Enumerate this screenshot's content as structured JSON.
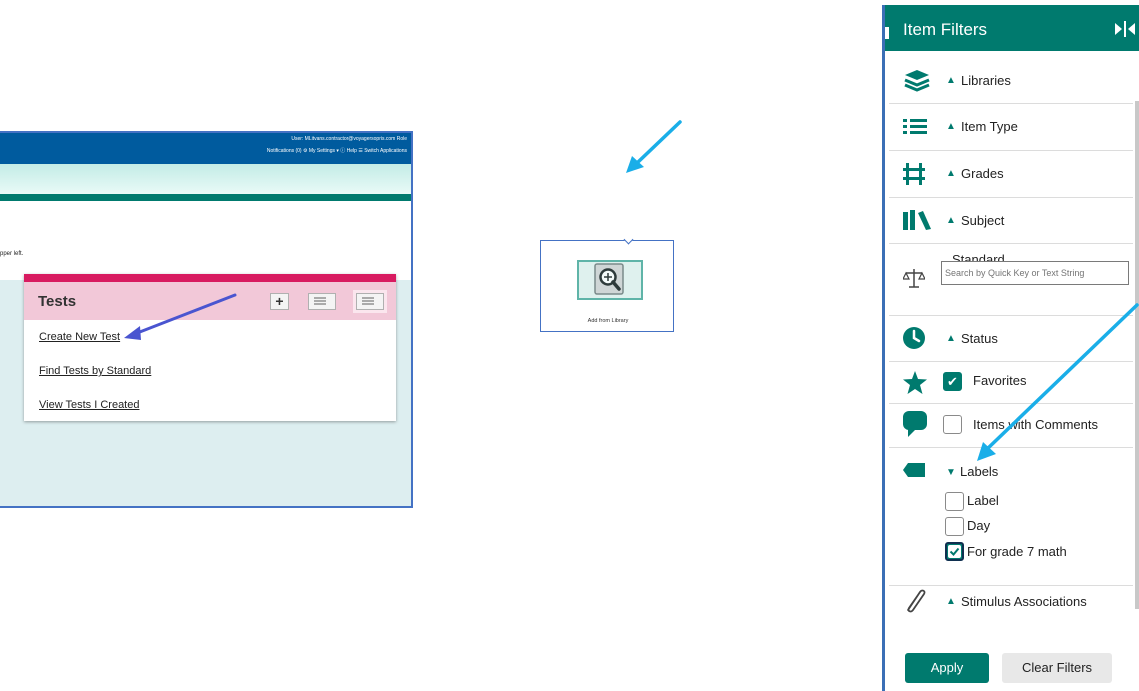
{
  "screenshot_tests": {
    "user_text": "User: MLitvans.contractor@voyagersopris.com  Role",
    "nav_text": "Notifications (0)    ⚙ My Settings ▾    ⓘ Help    ☰ Switch Applications",
    "instruction_fragment": "pper left.",
    "card_title": "Tests",
    "links": [
      "Create New Test",
      "Find Tests by Standard",
      "View Tests I Created"
    ],
    "plus_label": "+"
  },
  "add_from_library": {
    "label": "Add from Library"
  },
  "item_filters": {
    "title": "Item Filters",
    "triangle_up": "▲",
    "triangle_down": "▼",
    "check_mark": "✔",
    "sections": {
      "libraries": "Libraries",
      "item_type": "Item Type",
      "grades": "Grades",
      "subject": "Subject",
      "standard": "Standard",
      "status": "Status",
      "favorites": "Favorites",
      "items_with_comments": "Items with Comments",
      "labels": "Labels",
      "stimulus_associations": "Stimulus Associations"
    },
    "standard_placeholder": "Search by Quick Key or Text String",
    "favorites_checked": true,
    "items_with_comments_checked": false,
    "label_options": [
      {
        "label": "Label",
        "checked": false
      },
      {
        "label": "Day",
        "checked": false
      },
      {
        "label": "For grade 7 math",
        "checked": true
      }
    ],
    "apply_label": "Apply",
    "clear_label": "Clear Filters"
  },
  "colors": {
    "teal": "#007a6e",
    "pointer_arrow": "#1aaee8",
    "blue_nav": "#005b9e",
    "pink_accent": "#d81b60"
  }
}
